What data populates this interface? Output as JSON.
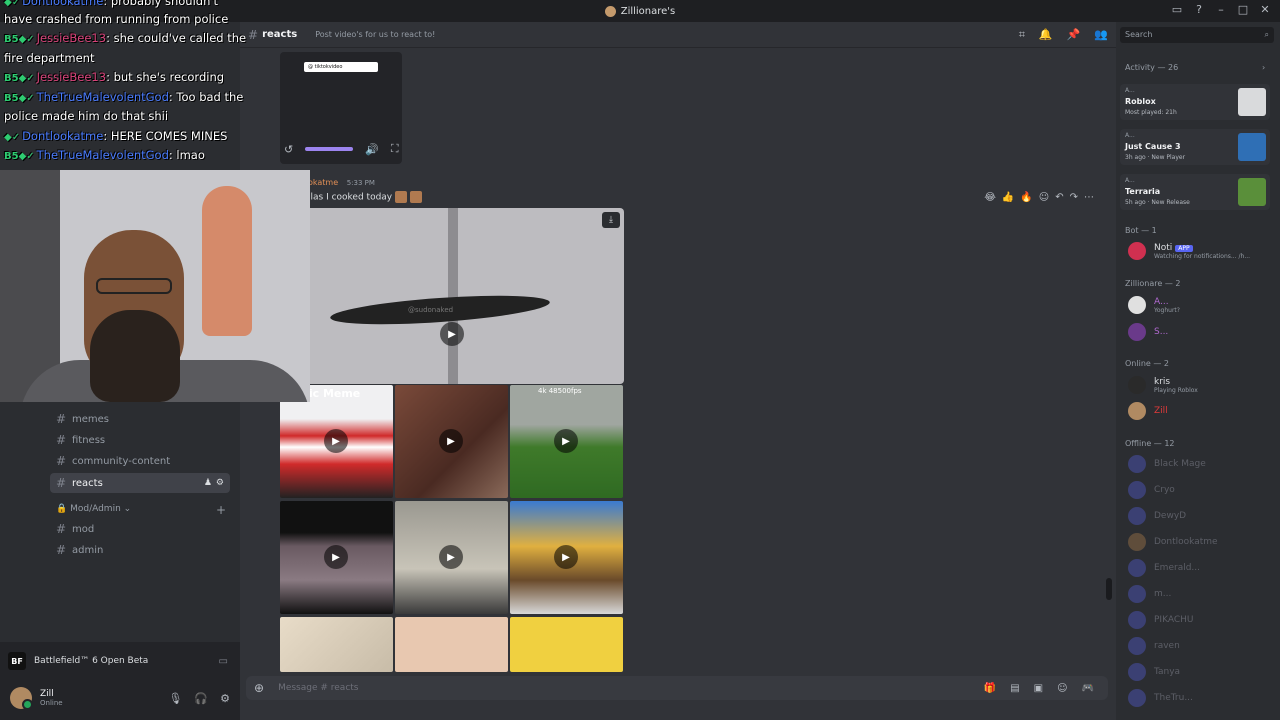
{
  "window": {
    "title": "Zillionare's"
  },
  "channel_header": {
    "name": "reacts",
    "topic": "Post video's for us to react to!"
  },
  "sidebar": {
    "channels": [
      {
        "label": "memes"
      },
      {
        "label": "fitness"
      },
      {
        "label": "community-content"
      },
      {
        "label": "reacts"
      }
    ],
    "category": "Mod/Admin",
    "mod_channels": [
      {
        "label": "mod"
      },
      {
        "label": "admin"
      }
    ]
  },
  "user_panel": {
    "activity": "Battlefield™ 6 Open Beta",
    "username": "Zill",
    "status": "Online"
  },
  "message": {
    "author": "okatme",
    "timestamp": "5:33 PM",
    "text": "llas I cooked today",
    "tiktok_handle": "@ tiktokvideo",
    "big_video_watermark": "@sudonaked"
  },
  "grid": {
    "tile1_caption": "rrasic Meme",
    "tile3_caption": "4k 48500fps"
  },
  "composer": {
    "placeholder": "Message # reacts"
  },
  "member_list": {
    "search_placeholder": "Search",
    "activity_header": "Activity — 26",
    "activities": [
      {
        "user": "A...",
        "game": "Roblox",
        "detail": "Most played: 21h",
        "color": "#d9dadc"
      },
      {
        "user": "A...",
        "game": "Just Cause 3",
        "detail": "3h ago · New Player",
        "color": "#2f6fb5"
      },
      {
        "user": "A...",
        "game": "Terraria",
        "detail": "5h ago · New Release",
        "color": "#5a8f3a"
      }
    ],
    "bot_header": "Bot — 1",
    "bot": {
      "name": "Noti",
      "tag": "APP",
      "status": "Watching for notifications... /h..."
    },
    "role_header": "Zillionare — 2",
    "role_members": [
      {
        "name": "A...",
        "status": "Yoghurt?"
      },
      {
        "name": "S...",
        "status": ""
      }
    ],
    "online_header": "Online — 2",
    "online_members": [
      {
        "name": "kris",
        "status": "Playing Roblox"
      },
      {
        "name": "Zill",
        "status": ""
      }
    ],
    "offline_header": "Offline — 12",
    "offline_members": [
      "Black Mage",
      "Cryo",
      "DewyD",
      "Dontlookatme",
      "Emerald...",
      "m...",
      "PIKACHU",
      "raven",
      "Tanya",
      "TheTru..."
    ]
  },
  "stream_chat": [
    {
      "user": "Dontlookatme",
      "text": ": probably shouldn't"
    },
    {
      "user": "",
      "text": "have crashed from running from police"
    },
    {
      "user": "JessieBee13",
      "text": ": she could've called the"
    },
    {
      "user": "",
      "text": "fire department"
    },
    {
      "user": "JessieBee13",
      "text": ": but she's recording"
    },
    {
      "user": "TheTrueMalevolentGod",
      "text": ": Too bad the"
    },
    {
      "user": "",
      "text": "police made him do that shii"
    },
    {
      "user": "Dontlookatme",
      "text": ": HERE COMES MINES"
    },
    {
      "user": "TheTrueMalevolentGod",
      "text": ": lmao"
    }
  ]
}
